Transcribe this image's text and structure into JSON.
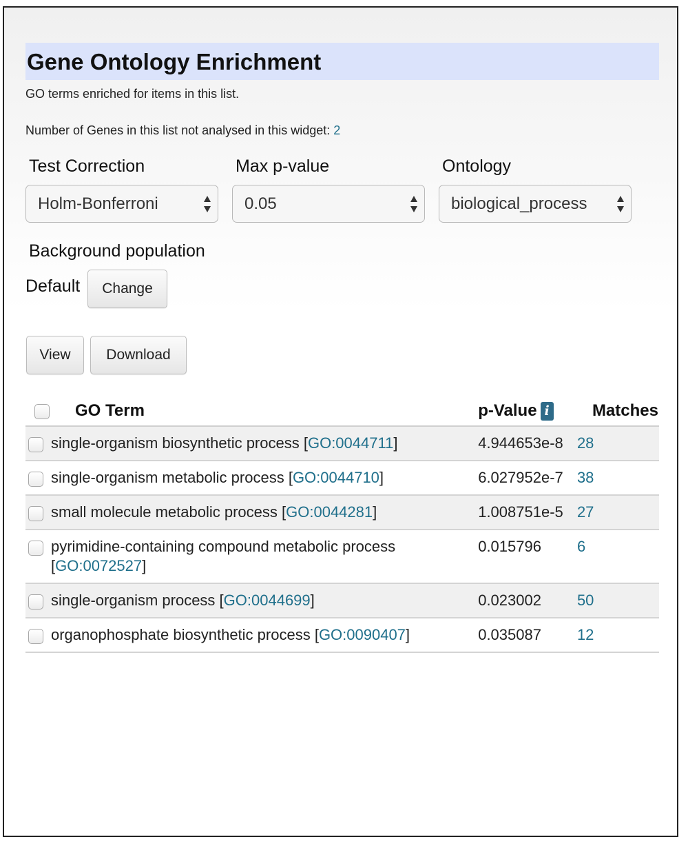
{
  "widget": {
    "title": "Gene Ontology Enrichment",
    "subtitle": "GO terms enriched for items in this list.",
    "not_analysed_label": "Number of Genes in this list not analysed in this widget:",
    "not_analysed_count": "2"
  },
  "selectors": {
    "test_correction": {
      "label": "Test Correction",
      "value": "Holm-Bonferroni"
    },
    "max_pvalue": {
      "label": "Max p-value",
      "value": "0.05"
    },
    "ontology": {
      "label": "Ontology",
      "value": "biological_process"
    }
  },
  "background": {
    "label": "Background population",
    "value": "Default",
    "change_button": "Change"
  },
  "actions": {
    "view": "View",
    "download": "Download"
  },
  "table": {
    "headers": {
      "term": "GO Term",
      "pvalue": "p-Value",
      "info": "i",
      "matches": "Matches"
    },
    "rows": [
      {
        "term": "single-organism biosynthetic process",
        "go_id": "GO:0044711",
        "pvalue": "4.944653e-8",
        "matches": "28"
      },
      {
        "term": "single-organism metabolic process",
        "go_id": "GO:0044710",
        "pvalue": "6.027952e-7",
        "matches": "38"
      },
      {
        "term": "small molecule metabolic process",
        "go_id": "GO:0044281",
        "pvalue": "1.008751e-5",
        "matches": "27"
      },
      {
        "term": "pyrimidine-containing compound metabolic process",
        "go_id": "GO:0072527",
        "pvalue": "0.015796",
        "matches": "6"
      },
      {
        "term": "single-organism process",
        "go_id": "GO:0044699",
        "pvalue": "0.023002",
        "matches": "50"
      },
      {
        "term": "organophosphate biosynthetic process",
        "go_id": "GO:0090407",
        "pvalue": "0.035087",
        "matches": "12"
      }
    ]
  },
  "colors": {
    "title_bg": "#dbe3fb",
    "link": "#1f6f8b",
    "info_badge": "#2e6b89",
    "row_stripe": "#f0f0f0"
  },
  "icons": {
    "select_arrows": "up-down-arrows-icon",
    "info": "info-icon"
  }
}
